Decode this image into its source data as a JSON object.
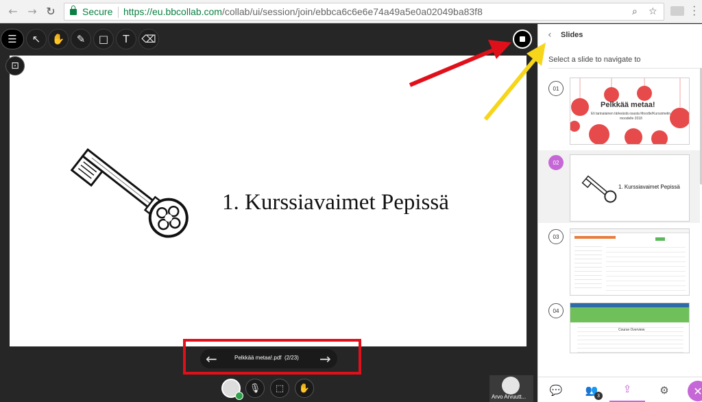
{
  "browser": {
    "secure_label": "Secure",
    "url_host": "https://eu.bbcollab.com",
    "url_path": "/collab/ui/session/join/ebbca6c6e6e74a49a5e0a02049ba83f8"
  },
  "presentation": {
    "slide_title": "1. Kurssiavaimet Pepissä",
    "file_label": "Pelkkää metaa!.pdf",
    "page_indicator": "(2/23)"
  },
  "panel": {
    "title": "Slides",
    "hint": "Select a slide to navigate to",
    "slides": [
      {
        "number": "01",
        "heading": "Pelkkää metaa!",
        "subheading": "Eli tarinalainen tärkeästä osasta Moodle/Kurssimetin",
        "subheading2": "moodelle 2018"
      },
      {
        "number": "02",
        "heading": "1. Kurssiavaimet Pepissä"
      },
      {
        "number": "03"
      },
      {
        "number": "04",
        "heading": "Course Overview"
      }
    ],
    "tab_badge": "3"
  },
  "user": {
    "name": "Arvo Arvuutt..."
  },
  "colors": {
    "accent": "#c567d6",
    "annotation_red": "#e0101a",
    "annotation_yellow": "#f7d51a",
    "secure_green": "#0b8043"
  }
}
